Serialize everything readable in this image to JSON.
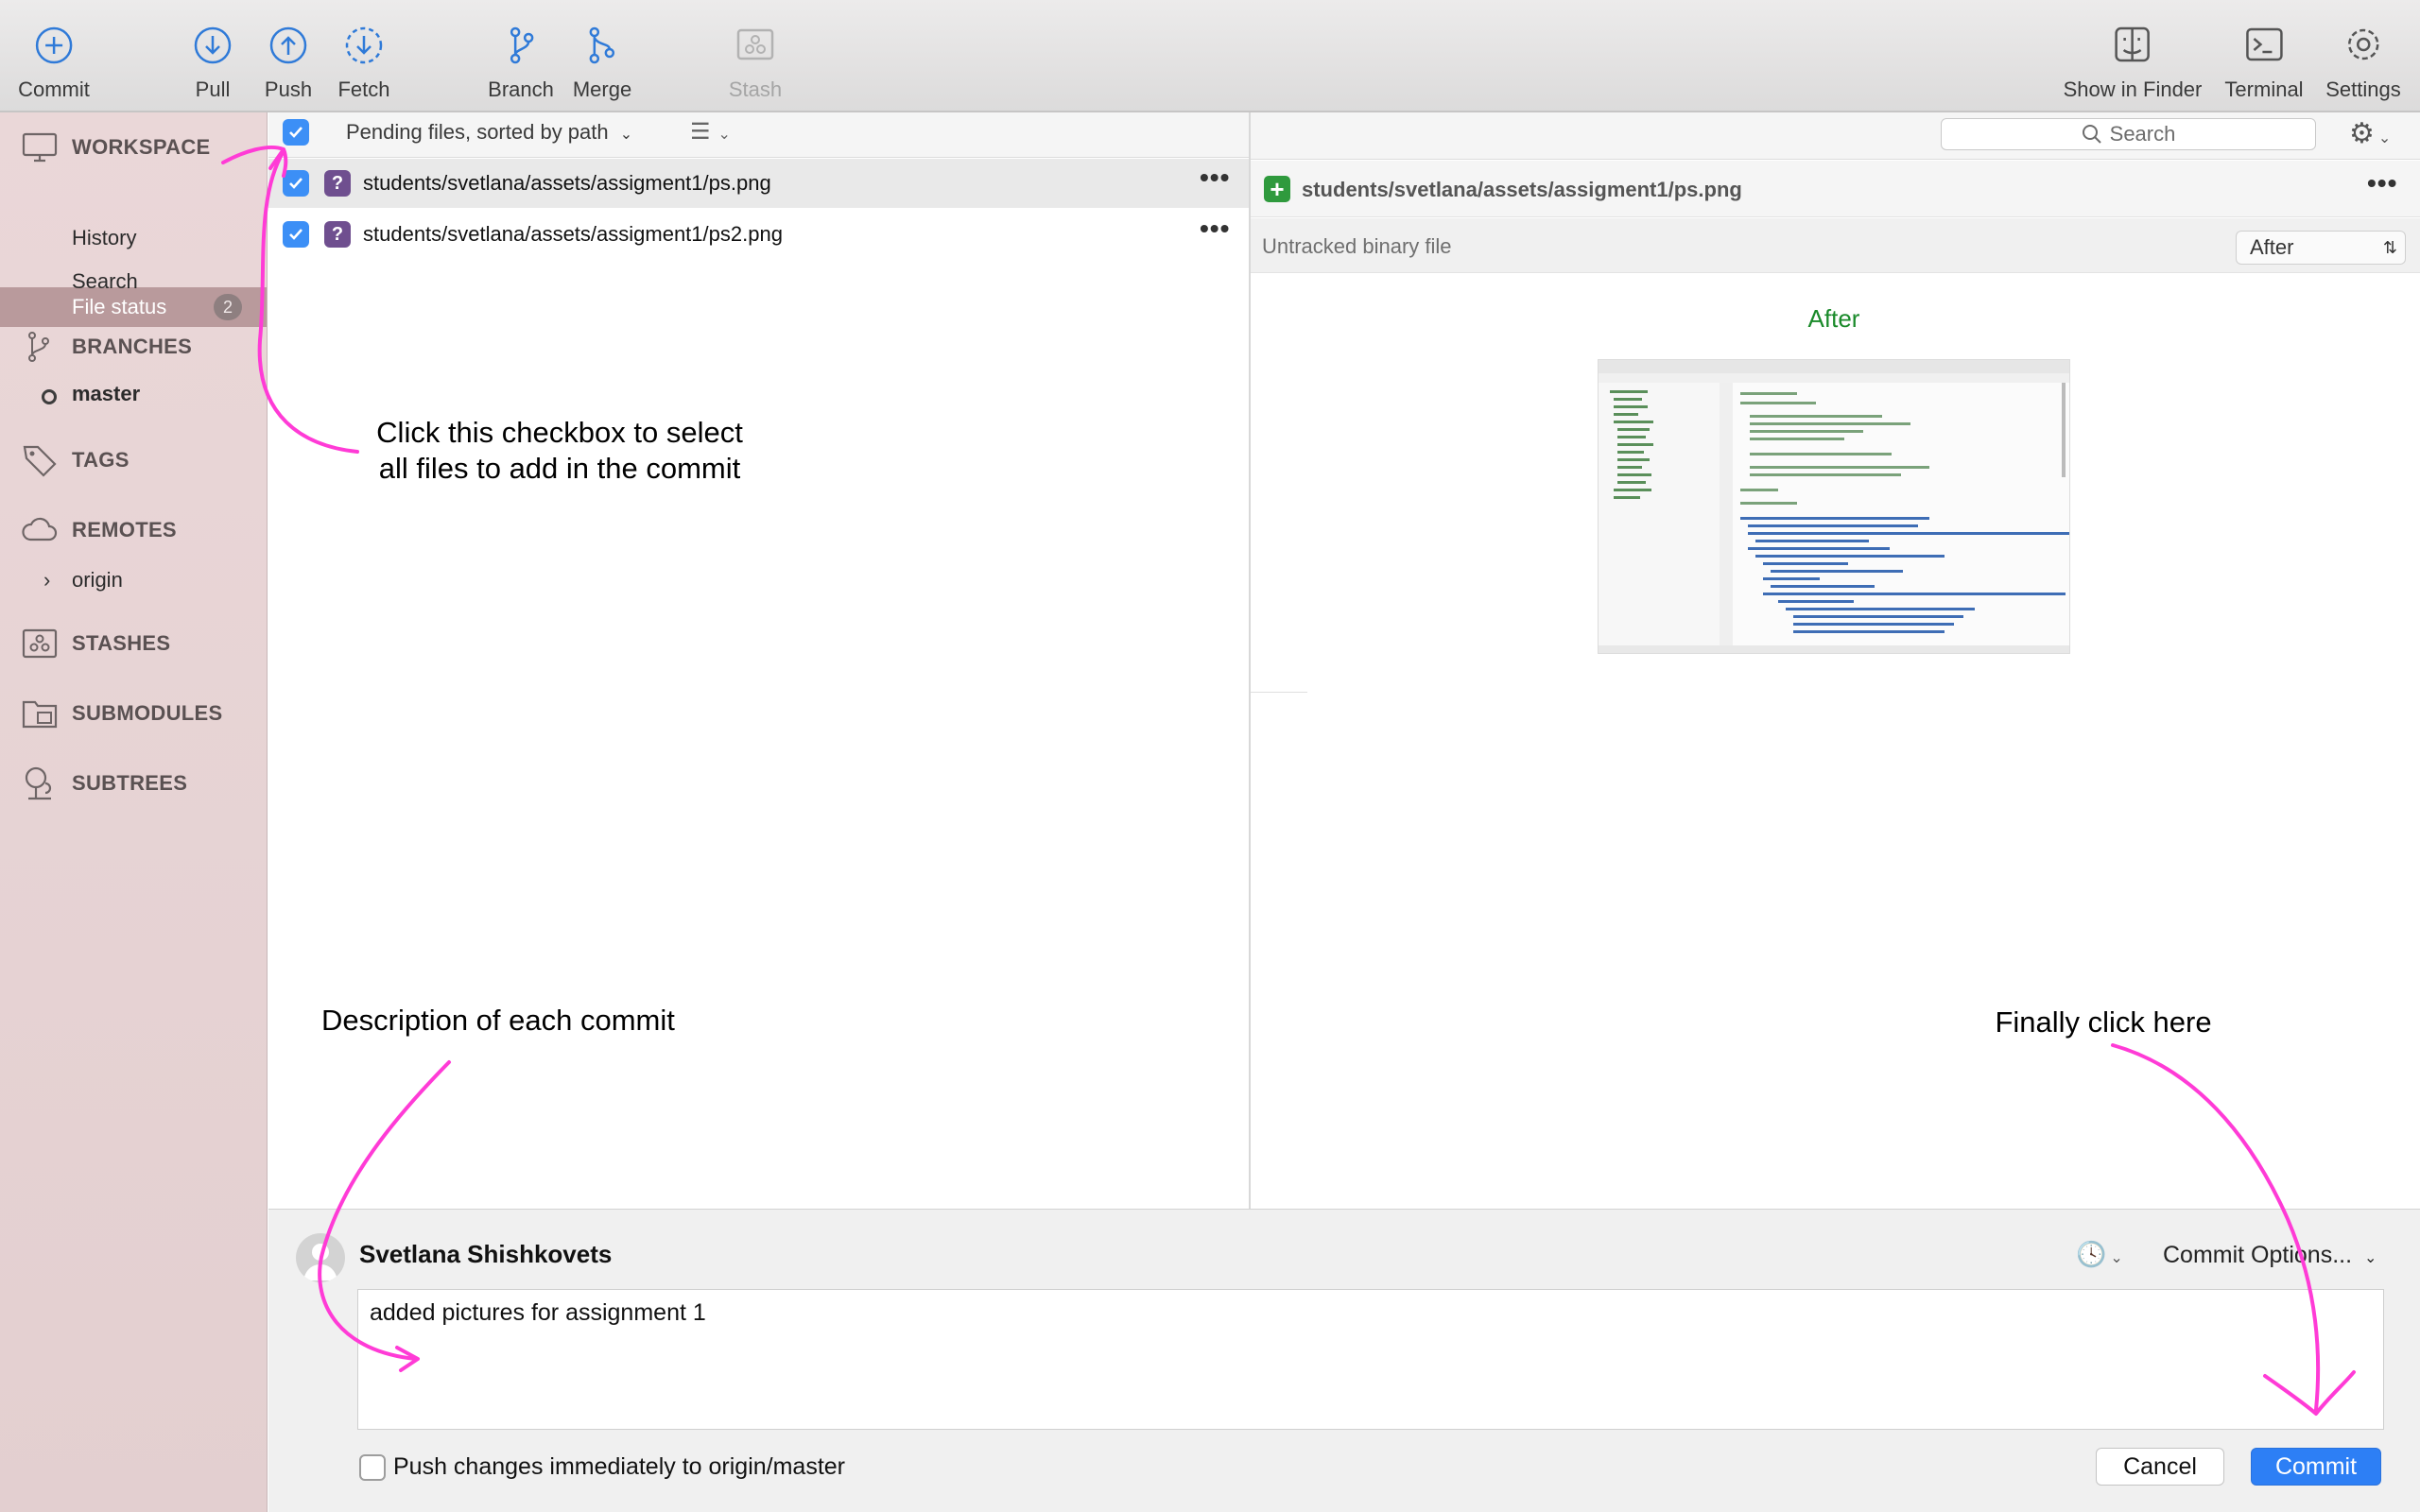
{
  "toolbar": {
    "commit": "Commit",
    "pull": "Pull",
    "push": "Push",
    "fetch": "Fetch",
    "branch": "Branch",
    "merge": "Merge",
    "stash": "Stash",
    "show_in_finder": "Show in Finder",
    "terminal": "Terminal",
    "settings": "Settings"
  },
  "sidebar": {
    "workspace": "WORKSPACE",
    "file_status": "File status",
    "file_status_count": "2",
    "history": "History",
    "search": "Search",
    "branches": "BRANCHES",
    "master": "master",
    "tags": "TAGS",
    "remotes": "REMOTES",
    "origin": "origin",
    "stashes": "STASHES",
    "submodules": "SUBMODULES",
    "subtrees": "SUBTREES"
  },
  "files": {
    "header_label": "Pending files, sorted by path",
    "items": [
      {
        "path": "students/svetlana/assets/assigment1/ps.png",
        "status": "?"
      },
      {
        "path": "students/svetlana/assets/assigment1/ps2.png",
        "status": "?"
      }
    ]
  },
  "search": {
    "placeholder": "Search"
  },
  "diff": {
    "file_path": "students/svetlana/assets/assigment1/ps.png",
    "subtitle": "Untracked binary file",
    "mode_select": "After",
    "image_label": "After"
  },
  "commit": {
    "author": "Svetlana Shishkovets",
    "message": "added pictures for assignment 1",
    "options_label": "Commit Options...",
    "push_immediately": "Push changes immediately to origin/master",
    "cancel": "Cancel",
    "commit_button": "Commit"
  },
  "annotations": {
    "checkbox_line1": "Click this checkbox to select",
    "checkbox_line2": "all files to add in the commit",
    "description": "Description of each commit",
    "finally": "Finally click here"
  },
  "colors": {
    "accent": "#2d7ff5",
    "annotation": "#ff3bd6",
    "sidebar": "#ead7d8"
  }
}
